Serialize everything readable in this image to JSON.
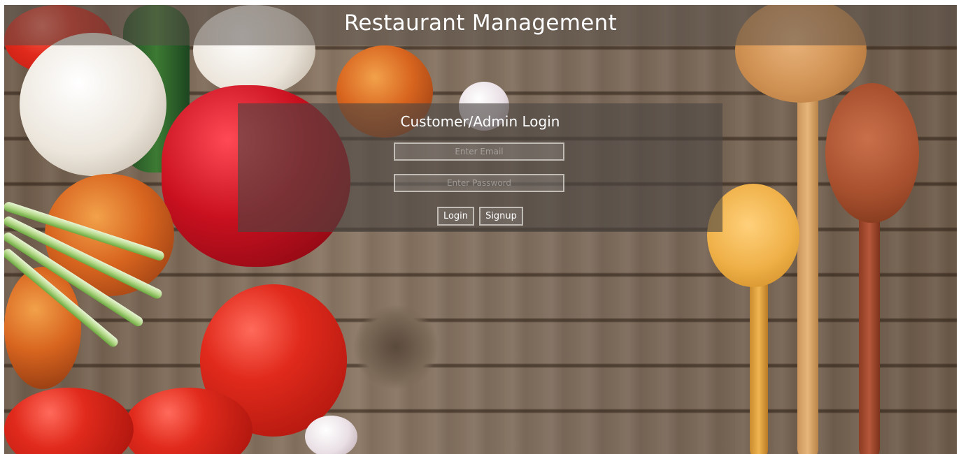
{
  "app": {
    "title": "Restaurant Management"
  },
  "login": {
    "title": "Customer/Admin Login",
    "email_placeholder": "Enter Email",
    "password_placeholder": "Enter Password",
    "login_label": "Login",
    "signup_label": "Signup"
  },
  "colors": {
    "header_overlay": "#5a5048",
    "panel_overlay": "#4b4642",
    "text": "#ffffff",
    "field_border": "#dcd7d2"
  }
}
